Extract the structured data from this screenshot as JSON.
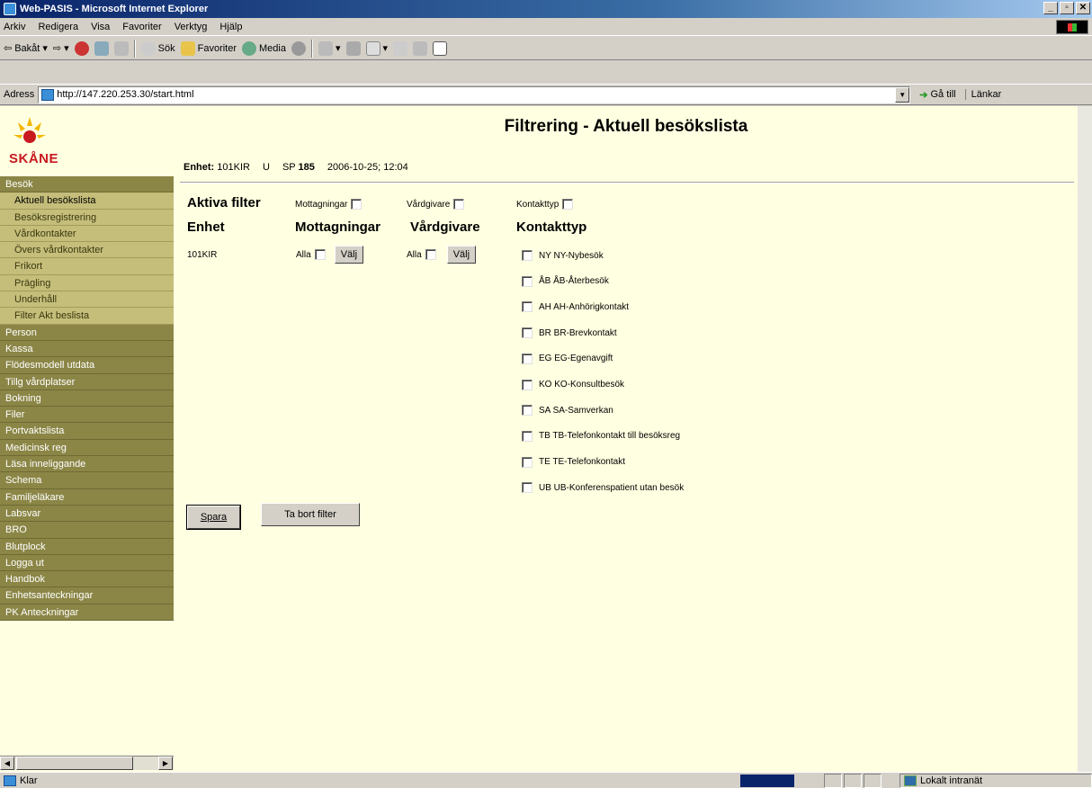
{
  "window": {
    "title": "Web-PASIS - Microsoft Internet Explorer"
  },
  "menu": [
    "Arkiv",
    "Redigera",
    "Visa",
    "Favoriter",
    "Verktyg",
    "Hjälp"
  ],
  "toolbar": {
    "back": "Bakåt",
    "search": "Sök",
    "favorites": "Favoriter",
    "media": "Media"
  },
  "address": {
    "label": "Adress",
    "url": "http://147.220.253.30/start.html",
    "go": "Gå till",
    "links": "Länkar"
  },
  "logo": {
    "text": "SKÅNE"
  },
  "sidebar": {
    "items": [
      {
        "label": "Besök",
        "type": "header"
      },
      {
        "label": "Aktuell besökslista",
        "type": "sub",
        "active": true
      },
      {
        "label": "Besöksregistrering",
        "type": "sub"
      },
      {
        "label": "Vårdkontakter",
        "type": "sub"
      },
      {
        "label": "Övers vårdkontakter",
        "type": "sub"
      },
      {
        "label": "Frikort",
        "type": "sub"
      },
      {
        "label": "Prägling",
        "type": "sub"
      },
      {
        "label": "Underhåll",
        "type": "sub"
      },
      {
        "label": "Filter Akt beslista",
        "type": "sub"
      },
      {
        "label": "Person",
        "type": "header"
      },
      {
        "label": "Kassa",
        "type": "header"
      },
      {
        "label": "Flödesmodell utdata",
        "type": "header"
      },
      {
        "label": "Tillg vårdplatser",
        "type": "header"
      },
      {
        "label": "Bokning",
        "type": "header"
      },
      {
        "label": "Filer",
        "type": "header"
      },
      {
        "label": "Portvaktslista",
        "type": "header"
      },
      {
        "label": "Medicinsk reg",
        "type": "header"
      },
      {
        "label": "Läsa inneliggande",
        "type": "header"
      },
      {
        "label": "Schema",
        "type": "header"
      },
      {
        "label": "Familjeläkare",
        "type": "header"
      },
      {
        "label": "Labsvar",
        "type": "header"
      },
      {
        "label": "BRO",
        "type": "header"
      },
      {
        "label": "Blutplock",
        "type": "header"
      },
      {
        "label": "Logga ut",
        "type": "header"
      },
      {
        "label": "Handbok",
        "type": "header"
      },
      {
        "label": "Enhetsanteckningar",
        "type": "header"
      },
      {
        "label": "PK Anteckningar",
        "type": "header"
      }
    ]
  },
  "page": {
    "title": "Filtrering - Aktuell besökslista",
    "info": {
      "enhet_label": "Enhet:",
      "enhet_value": "101KIR",
      "u": "U",
      "sp_label": "SP",
      "sp_value": "185",
      "datetime": "2006-10-25; 12:04"
    },
    "active_filters": {
      "heading": "Aktiva filter",
      "mottagningar": "Mottagningar",
      "vardgivare": "Vårdgivare",
      "kontakttyp": "Kontakttyp"
    },
    "columns": {
      "enhet": "Enhet",
      "mottagningar": "Mottagningar",
      "vardgivare": "Vårdgivare",
      "kontakttyp": "Kontakttyp"
    },
    "enhet_value": "101KIR",
    "alla": "Alla",
    "valj": "Välj",
    "kontakttyper": [
      "NY NY-Nybesök",
      "ÅB ÅB-Återbesök",
      "AH AH-Anhörigkontakt",
      "BR BR-Brevkontakt",
      "EG EG-Egenavgift",
      "KO KO-Konsultbesök",
      "SA SA-Samverkan",
      "TB TB-Telefonkontakt till besöksreg",
      "TE TE-Telefonkontakt",
      "UB UB-Konferenspatient utan besök"
    ],
    "buttons": {
      "save": "Spara",
      "remove_filter": "Ta bort filter"
    }
  },
  "status": {
    "text": "Klar",
    "zone": "Lokalt intranät"
  }
}
